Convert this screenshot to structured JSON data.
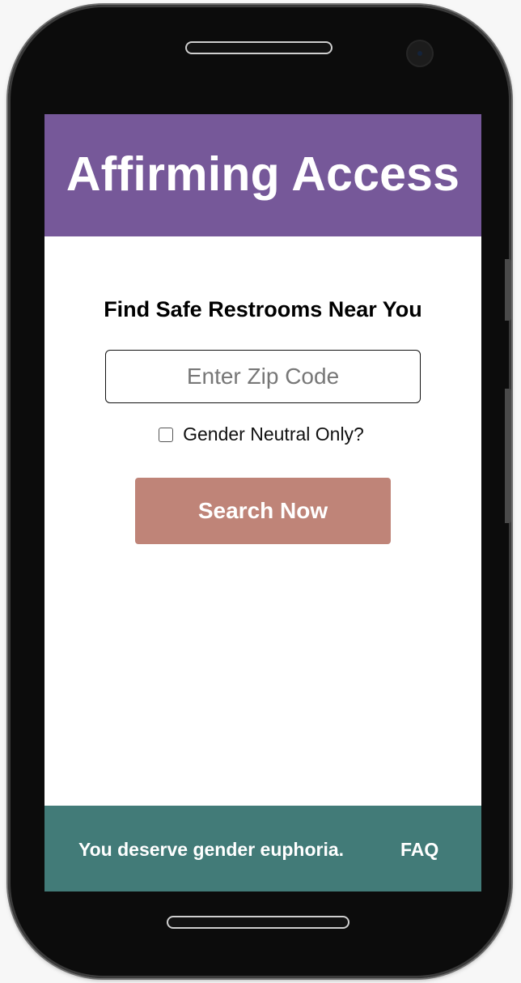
{
  "header": {
    "title": "Affirming Access"
  },
  "search": {
    "heading": "Find Safe Restrooms Near You",
    "zip_placeholder": "Enter Zip Code",
    "zip_value": "",
    "gender_neutral_label": "Gender Neutral Only?",
    "gender_neutral_checked": false,
    "button_label": "Search Now"
  },
  "footer": {
    "tagline": "You deserve gender euphoria.",
    "faq_label": "FAQ"
  },
  "colors": {
    "header_bg": "#765899",
    "button_bg": "#bf8478",
    "footer_bg": "#427b78"
  },
  "icons": {
    "checkbox": "checkbox-unchecked-icon"
  }
}
